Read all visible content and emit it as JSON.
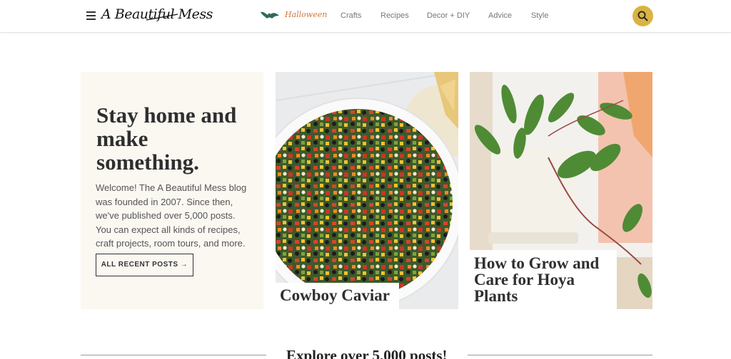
{
  "header": {
    "logo": "A Beautiful Mess",
    "halloween_label": "Halloween",
    "nav": [
      {
        "label": "Crafts"
      },
      {
        "label": "Recipes"
      },
      {
        "label": "Decor + DIY"
      },
      {
        "label": "Advice"
      },
      {
        "label": "Style"
      }
    ],
    "icons": {
      "menu": "hamburger-icon",
      "bat": "bat-icon",
      "search": "search-icon"
    },
    "colors": {
      "accent": "#d9b343",
      "halloween": "#d1783a"
    }
  },
  "intro": {
    "title": "Stay home and make something.",
    "body": "Welcome! The A Beautiful Mess blog was founded in 2007. Since then, we've published over 5,000 posts. You can expect all kinds of recipes, craft projects, room tours, and more.",
    "button_label": "ALL RECENT POSTS →",
    "background": "#fbf8f2"
  },
  "posts": [
    {
      "title": "Cowboy Caviar"
    },
    {
      "title": "How to Grow and Care for Hoya Plants"
    }
  ],
  "explore": {
    "heading": "Explore over 5,000 posts!"
  }
}
